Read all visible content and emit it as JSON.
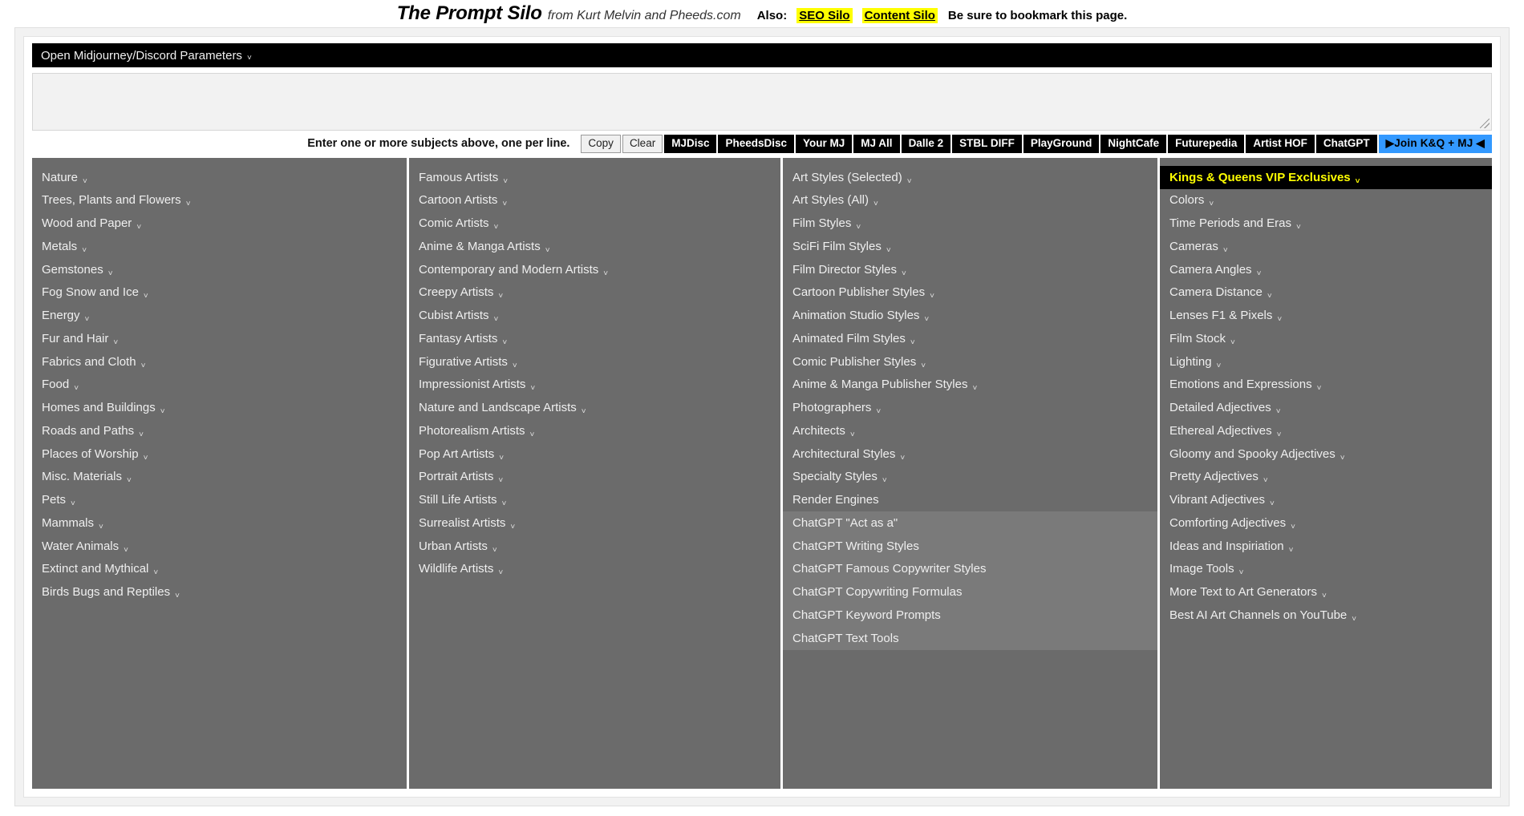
{
  "header": {
    "brand": "The Prompt Silo",
    "byline": "from Kurt Melvin and Pheeds.com",
    "also_label": "Also:",
    "link_seo": "SEO Silo",
    "link_content": "Content Silo",
    "bookmark_note": "Be sure to bookmark this page.",
    "highlight_color": "#ffff00"
  },
  "params": {
    "label": "Open Midjourney/Discord Parameters",
    "chevron": "chevron-down",
    "background": "#000000"
  },
  "subject_input": {
    "value": "",
    "placeholder": ""
  },
  "toolbar": {
    "note": "Enter one or more subjects above, one per line.",
    "buttons": [
      {
        "label": "Copy",
        "style": "light"
      },
      {
        "label": "Clear",
        "style": "light"
      },
      {
        "label": "MJDisc",
        "style": "dark"
      },
      {
        "label": "PheedsDisc",
        "style": "dark"
      },
      {
        "label": "Your MJ",
        "style": "dark"
      },
      {
        "label": "MJ All",
        "style": "dark"
      },
      {
        "label": "Dalle 2",
        "style": "dark"
      },
      {
        "label": "STBL DIFF",
        "style": "dark"
      },
      {
        "label": "PlayGround",
        "style": "dark"
      },
      {
        "label": "NightCafe",
        "style": "dark"
      },
      {
        "label": "Futurepedia",
        "style": "dark"
      },
      {
        "label": "Artist HOF",
        "style": "dark"
      },
      {
        "label": "ChatGPT",
        "style": "dark"
      }
    ],
    "join_button": {
      "label": "▶Join K&Q + MJ ◀",
      "color": "#3399ff"
    }
  },
  "columns": [
    {
      "name": "subjects",
      "items": [
        {
          "label": "Nature",
          "chevron": true
        },
        {
          "label": "Trees, Plants and Flowers",
          "chevron": true
        },
        {
          "label": "Wood and Paper",
          "chevron": true
        },
        {
          "label": "Metals",
          "chevron": true
        },
        {
          "label": "Gemstones",
          "chevron": true
        },
        {
          "label": "Fog Snow and Ice",
          "chevron": true
        },
        {
          "label": "Energy",
          "chevron": true
        },
        {
          "label": "Fur and Hair",
          "chevron": true
        },
        {
          "label": "Fabrics and Cloth",
          "chevron": true
        },
        {
          "label": "Food",
          "chevron": true
        },
        {
          "label": "Homes and Buildings",
          "chevron": true
        },
        {
          "label": "Roads and Paths",
          "chevron": true
        },
        {
          "label": "Places of Worship",
          "chevron": true
        },
        {
          "label": "Misc. Materials",
          "chevron": true
        },
        {
          "label": "Pets",
          "chevron": true
        },
        {
          "label": "Mammals",
          "chevron": true
        },
        {
          "label": "Water Animals",
          "chevron": true
        },
        {
          "label": "Extinct and Mythical",
          "chevron": true
        },
        {
          "label": "Birds Bugs and Reptiles",
          "chevron": true
        }
      ]
    },
    {
      "name": "artists",
      "items": [
        {
          "label": "Famous Artists",
          "chevron": true
        },
        {
          "label": "Cartoon Artists",
          "chevron": true
        },
        {
          "label": "Comic Artists",
          "chevron": true
        },
        {
          "label": "Anime & Manga Artists",
          "chevron": true
        },
        {
          "label": "Contemporary and Modern Artists",
          "chevron": true
        },
        {
          "label": "Creepy Artists",
          "chevron": true
        },
        {
          "label": "Cubist Artists",
          "chevron": true
        },
        {
          "label": "Fantasy Artists",
          "chevron": true
        },
        {
          "label": "Figurative Artists",
          "chevron": true
        },
        {
          "label": "Impressionist Artists",
          "chevron": true
        },
        {
          "label": "Nature and Landscape Artists",
          "chevron": true
        },
        {
          "label": "Photorealism Artists",
          "chevron": true
        },
        {
          "label": "Pop Art Artists",
          "chevron": true
        },
        {
          "label": "Portrait Artists",
          "chevron": true
        },
        {
          "label": "Still Life Artists",
          "chevron": true
        },
        {
          "label": "Surrealist Artists",
          "chevron": true
        },
        {
          "label": "Urban Artists",
          "chevron": true
        },
        {
          "label": "Wildlife Artists",
          "chevron": true
        }
      ]
    },
    {
      "name": "styles",
      "items": [
        {
          "label": "Art Styles (Selected)",
          "chevron": true
        },
        {
          "label": "Art Styles (All)",
          "chevron": true
        },
        {
          "label": "Film Styles",
          "chevron": true
        },
        {
          "label": "SciFi Film Styles",
          "chevron": true
        },
        {
          "label": "Film Director Styles",
          "chevron": true
        },
        {
          "label": "Cartoon Publisher Styles",
          "chevron": true
        },
        {
          "label": "Animation Studio Styles",
          "chevron": true
        },
        {
          "label": "Animated Film Styles",
          "chevron": true
        },
        {
          "label": "Comic Publisher Styles",
          "chevron": true
        },
        {
          "label": "Anime & Manga Publisher Styles",
          "chevron": true
        },
        {
          "label": "Photographers",
          "chevron": true
        },
        {
          "label": "Architects",
          "chevron": true
        },
        {
          "label": "Architectural Styles",
          "chevron": true
        },
        {
          "label": "Specialty Styles",
          "chevron": true
        },
        {
          "label": "Render Engines",
          "chevron": false
        },
        {
          "label": "ChatGPT \"Act as a\"",
          "chevron": false,
          "variant": "gpt"
        },
        {
          "label": "ChatGPT Writing Styles",
          "chevron": false,
          "variant": "gpt"
        },
        {
          "label": "ChatGPT Famous Copywriter Styles",
          "chevron": false,
          "variant": "gpt"
        },
        {
          "label": "ChatGPT Copywriting Formulas",
          "chevron": false,
          "variant": "gpt"
        },
        {
          "label": "ChatGPT Keyword Prompts",
          "chevron": false,
          "variant": "gpt"
        },
        {
          "label": "ChatGPT Text Tools",
          "chevron": false,
          "variant": "gpt"
        }
      ]
    },
    {
      "name": "modifiers",
      "items": [
        {
          "label": "Kings & Queens VIP Exclusives",
          "chevron": true,
          "variant": "vip"
        },
        {
          "label": "Colors",
          "chevron": true
        },
        {
          "label": "Time Periods and Eras",
          "chevron": true
        },
        {
          "label": "Cameras",
          "chevron": true
        },
        {
          "label": "Camera Angles",
          "chevron": true
        },
        {
          "label": "Camera Distance",
          "chevron": true
        },
        {
          "label": "Lenses F1 & Pixels",
          "chevron": true
        },
        {
          "label": "Film Stock",
          "chevron": true
        },
        {
          "label": "Lighting",
          "chevron": true
        },
        {
          "label": "Emotions and Expressions",
          "chevron": true
        },
        {
          "label": "Detailed Adjectives",
          "chevron": true
        },
        {
          "label": "Ethereal Adjectives",
          "chevron": true
        },
        {
          "label": "Gloomy and Spooky Adjectives",
          "chevron": true
        },
        {
          "label": "Pretty Adjectives",
          "chevron": true
        },
        {
          "label": "Vibrant Adjectives",
          "chevron": true
        },
        {
          "label": "Comforting Adjectives",
          "chevron": true
        },
        {
          "label": "Ideas and Inspiriation",
          "chevron": true
        },
        {
          "label": "Image Tools",
          "chevron": true
        },
        {
          "label": "More Text to Art Generators",
          "chevron": true
        },
        {
          "label": "Best AI Art Channels on YouTube",
          "chevron": true
        }
      ]
    }
  ]
}
